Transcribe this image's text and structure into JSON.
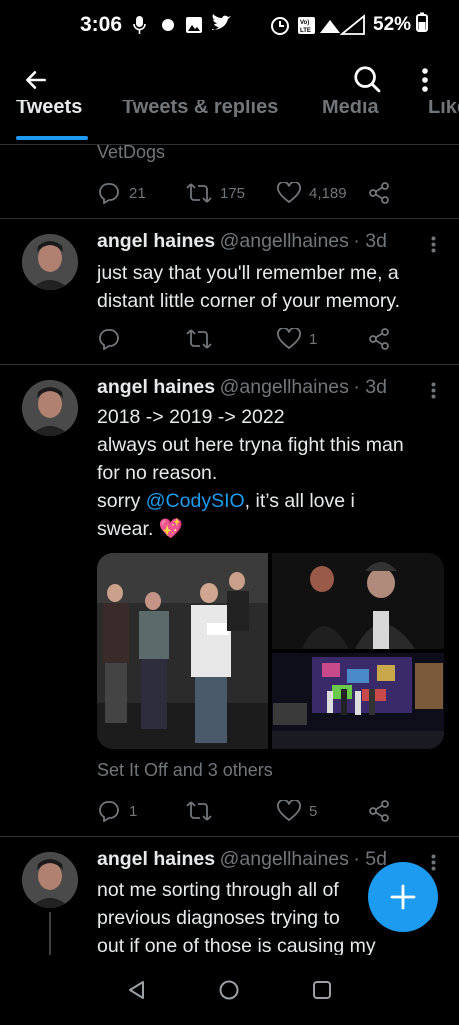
{
  "status_bar": {
    "time": "3:06",
    "battery": "52%"
  },
  "tabs": [
    {
      "label": "Tweets",
      "active": true
    },
    {
      "label": "Tweets & replies",
      "active": false
    },
    {
      "label": "Media",
      "active": false
    },
    {
      "label": "Likes",
      "active": false
    }
  ],
  "tweet0": {
    "social_context": "VetDogs",
    "replies": "21",
    "retweets": "175",
    "likes": "4,189"
  },
  "tweet1": {
    "name": "angel haines",
    "handle": "@angellhaines",
    "time": "· 3d",
    "text_line1": "just say that you'll remember me, a",
    "text_line2": "distant little corner of your memory.",
    "likes": "1"
  },
  "tweet2": {
    "name": "angel haines",
    "handle": "@angellhaines",
    "time": "· 3d",
    "line1": "2018 -> 2019 -> 2022",
    "line2": "always out here tryna fight this man",
    "line3": "for no reason.",
    "line4_pre": "sorry ",
    "mention": "@CodySIO",
    "line4_post": ", it’s all love i",
    "line5": "swear. 💖",
    "tagged": "Set It Off and 3 others",
    "replies": "1",
    "likes": "5"
  },
  "tweet3": {
    "name": "angel haines",
    "handle": "@angellhaines",
    "time": "· 5d",
    "line1": "not me sorting through all of",
    "line2": "previous diagnoses trying to",
    "line3": "out if one of those is causing my"
  },
  "colors": {
    "accent": "#1d9bf0",
    "background": "#000000",
    "muted": "#71767b",
    "divider": "#2f3336"
  }
}
